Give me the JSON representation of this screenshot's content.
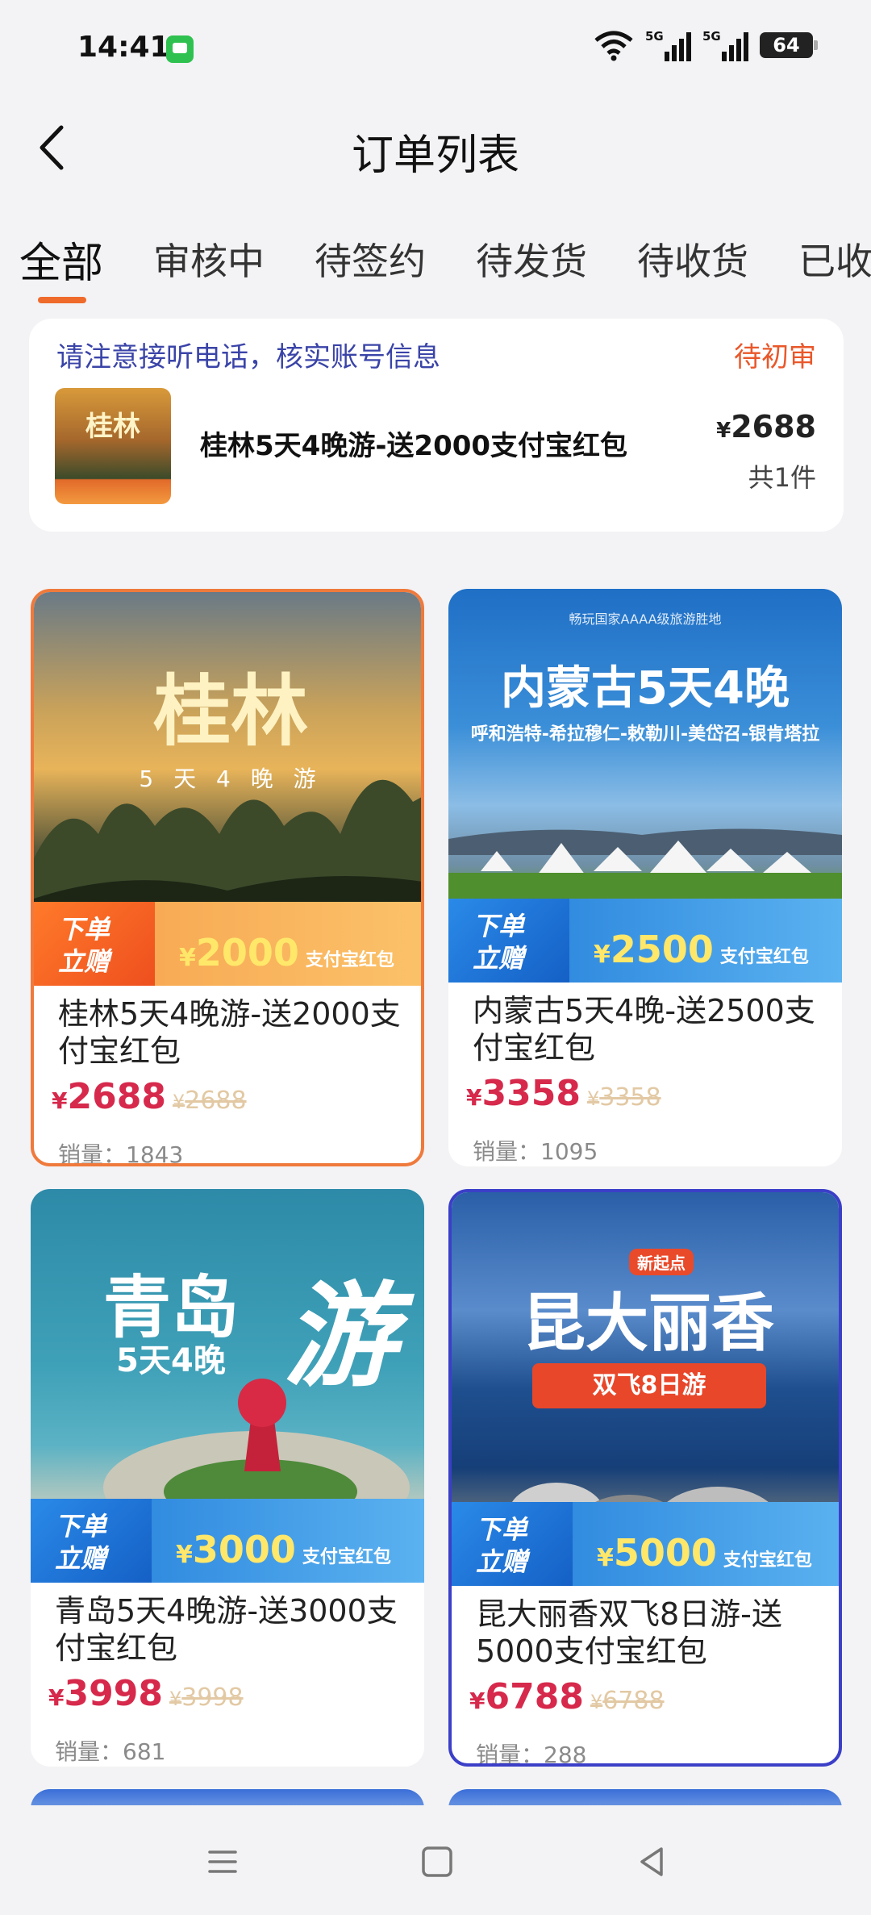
{
  "status_bar": {
    "time": "14:41",
    "signal_1": "5G",
    "signal_2": "5G",
    "battery": "64"
  },
  "header": {
    "title": "订单列表"
  },
  "tabs": [
    {
      "label": "全部"
    },
    {
      "label": "审核中"
    },
    {
      "label": "待签约"
    },
    {
      "label": "待发货"
    },
    {
      "label": "待收货"
    },
    {
      "label": "已收"
    }
  ],
  "order": {
    "notice": "请注意接听电话，核实账号信息",
    "status": "待初审",
    "thumb_text": "桂林",
    "name": "桂林5天4晚游-送2000支付宝红包",
    "currency": "¥",
    "price": "2688",
    "count": "共1件"
  },
  "products": [
    {
      "image_title": "桂林",
      "image_subtitle": "5 天 4 晚 游",
      "promo_tag": [
        "下单",
        "立赠"
      ],
      "promo_amount": "2000",
      "promo_suffix": "支付宝红包",
      "name": "桂林5天4晚游-送2000支付宝红包",
      "price": "2688",
      "original_price": "2688",
      "sales": "销量：1843"
    },
    {
      "image_title": "内蒙古5天4晚",
      "image_subtitle": "呼和浩特-希拉穆仁-敕勒川-美岱召-银肯塔拉",
      "image_caption": "畅玩国家AAAA级旅游胜地",
      "promo_tag": [
        "下单",
        "立赠"
      ],
      "promo_amount": "2500",
      "promo_suffix": "支付宝红包",
      "name": "内蒙古5天4晚-送2500支付宝红包",
      "price": "3358",
      "original_price": "3358",
      "sales": "销量：1095"
    },
    {
      "image_title": "青岛",
      "image_title_2": "游",
      "image_subtitle": "5天4晚",
      "promo_tag": [
        "下单",
        "立赠"
      ],
      "promo_amount": "3000",
      "promo_suffix": "支付宝红包",
      "name": "青岛5天4晚游-送3000支付宝红包",
      "price": "3998",
      "original_price": "3998",
      "sales": "销量：681"
    },
    {
      "image_title": "昆大丽香",
      "image_badge": "新起点",
      "image_subtitle": "双飞8日游",
      "promo_tag": [
        "下单",
        "立赠"
      ],
      "promo_amount": "5000",
      "promo_suffix": "支付宝红包",
      "name": "昆大丽香双飞8日游-送5000支付宝红包",
      "price": "6788",
      "original_price": "6788",
      "sales": "销量：288"
    }
  ],
  "colors": {
    "accent": "#ef6b2b",
    "price": "#d6294b",
    "notice": "#3a44a8",
    "status": "#e9582a"
  }
}
